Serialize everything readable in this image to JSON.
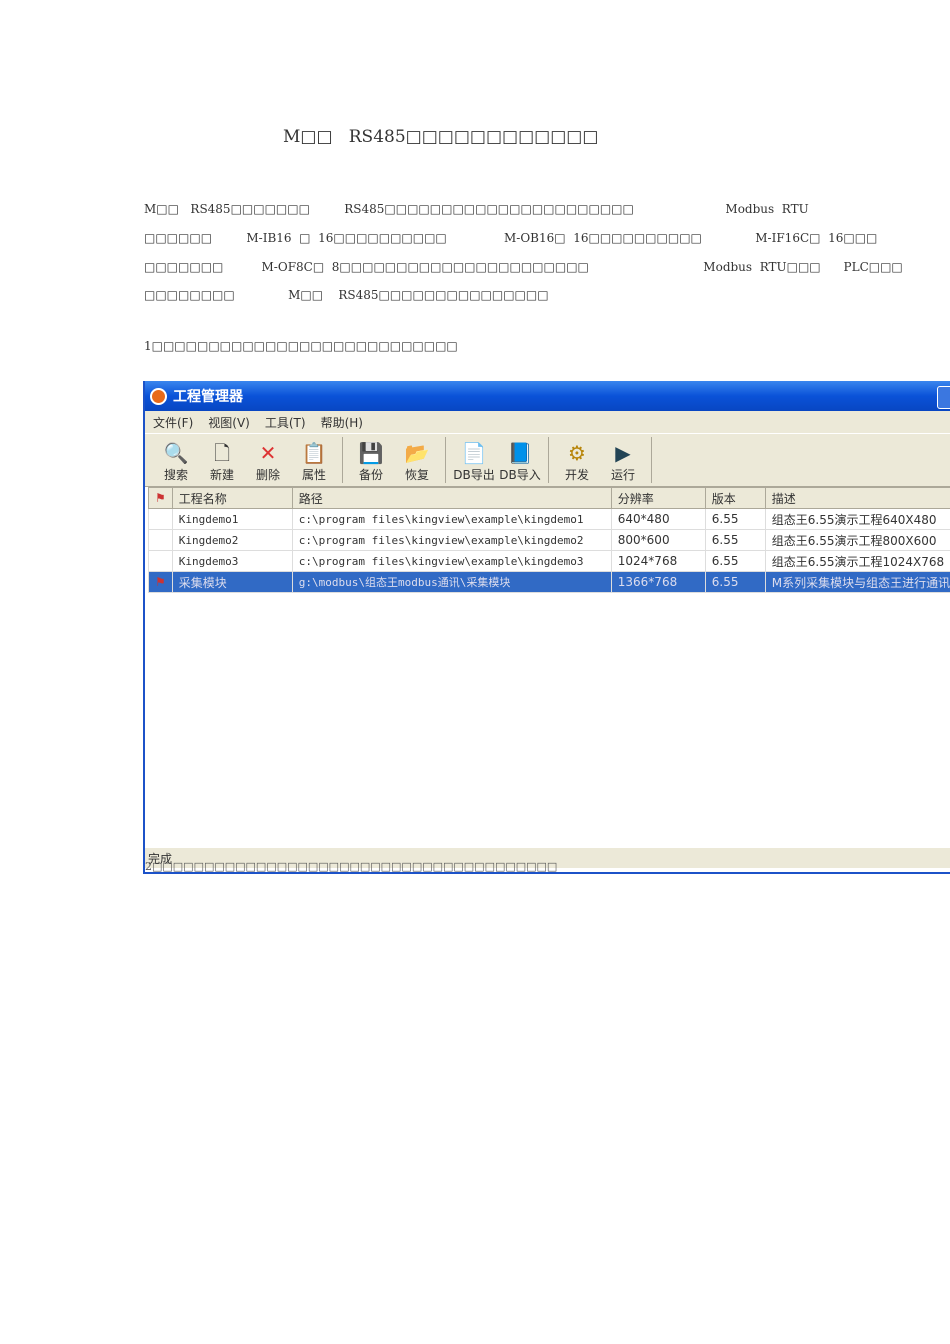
{
  "title": "M□□   RS485□□□□□□□□□□□□",
  "para": [
    "M□□   RS485□□□□□□□         RS485□□□□□□□□□□□□□□□□□□□□□□                        Modbus  RTU",
    "□□□□□□         M-IB16  □  16□□□□□□□□□□               M-OB16□  16□□□□□□□□□□              M-IF16C□  16□□□",
    "□□□□□□□          M-OF8C□  8□□□□□□□□□□□□□□□□□□□□□□                              Modbus  RTU□□□      PLC□□□",
    "□□□□□□□□              M□□    RS485□□□□□□□□□□□□□□□"
  ],
  "step1": "1□□□□□□□□□□□□□□□□□□□□□□□□□□□",
  "window": {
    "title": "工程管理器",
    "menu": [
      "文件(F)",
      "视图(V)",
      "工具(T)",
      "帮助(H)"
    ],
    "toolbar": [
      {
        "label": "搜索",
        "icon": "🔍"
      },
      {
        "label": "新建",
        "icon": "🗋"
      },
      {
        "label": "删除",
        "icon": "✕"
      },
      {
        "label": "属性",
        "icon": "📋"
      },
      {
        "label": "备份",
        "icon": "💾"
      },
      {
        "label": "恢复",
        "icon": "📂"
      },
      {
        "label": "DB导出",
        "icon": "📄"
      },
      {
        "label": "DB导入",
        "icon": "📘"
      },
      {
        "label": "开发",
        "icon": "⚙"
      },
      {
        "label": "运行",
        "icon": "▶"
      }
    ],
    "columns": [
      "工程名称",
      "路径",
      "分辨率",
      "版本",
      "描述"
    ],
    "rows": [
      [
        "Kingdemo1",
        "c:\\program files\\kingview\\example\\kingdemo1",
        "640*480",
        "6.55",
        "组态王6.55演示工程640X480"
      ],
      [
        "Kingdemo2",
        "c:\\program files\\kingview\\example\\kingdemo2",
        "800*600",
        "6.55",
        "组态王6.55演示工程800X600"
      ],
      [
        "Kingdemo3",
        "c:\\program files\\kingview\\example\\kingdemo3",
        "1024*768",
        "6.55",
        "组态王6.55演示工程1024X768"
      ],
      [
        "采集模块",
        "g:\\modbus\\组态王modbus通讯\\采集模块",
        "1366*768",
        "6.55",
        "M系列采集模块与组态王进行通讯"
      ]
    ],
    "status": "完成"
  },
  "caption": "2□□□□□□□□□□□□□□□□□□□□□□□□□□□□□□□□□□□□□□□"
}
